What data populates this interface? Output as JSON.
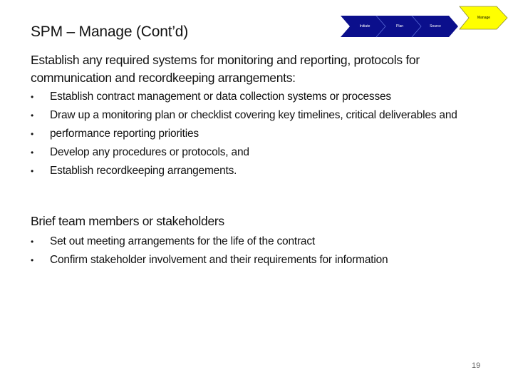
{
  "slide": {
    "title": "SPM – Manage (Cont’d)",
    "page_number": "19"
  },
  "process_nav": {
    "colors": {
      "inactive_fill": "#0b0f8c",
      "inactive_divider": "#5a6cd8",
      "active_fill": "#ffff00",
      "active_border": "#8a8a30"
    },
    "stages": [
      {
        "label": "Initiate",
        "active": false
      },
      {
        "label": "Plan",
        "active": false
      },
      {
        "label": "Source",
        "active": false
      },
      {
        "label": "Manage",
        "active": true
      }
    ]
  },
  "sections": [
    {
      "heading": "Establish any required systems for monitoring and reporting, protocols for communication and recordkeeping arrangements:",
      "bullets": [
        {
          "text": "Establish contract management or data collection systems or processes"
        },
        {
          "text": "Draw up a monitoring plan or checklist covering key timelines, critical deliverables and"
        },
        {
          "text": "performance reporting priorities"
        },
        {
          "text": "Develop any procedures or protocols, and"
        },
        {
          "text": "Establish recordkeeping arrangements."
        }
      ]
    },
    {
      "heading": "Brief  team members or stakeholders",
      "bullets": [
        {
          "text": "Set out meeting arrangements for the life of the contract"
        },
        {
          "text": "Confirm stakeholder involvement and their requirements for information"
        }
      ]
    }
  ],
  "bullet_glyph": "•"
}
